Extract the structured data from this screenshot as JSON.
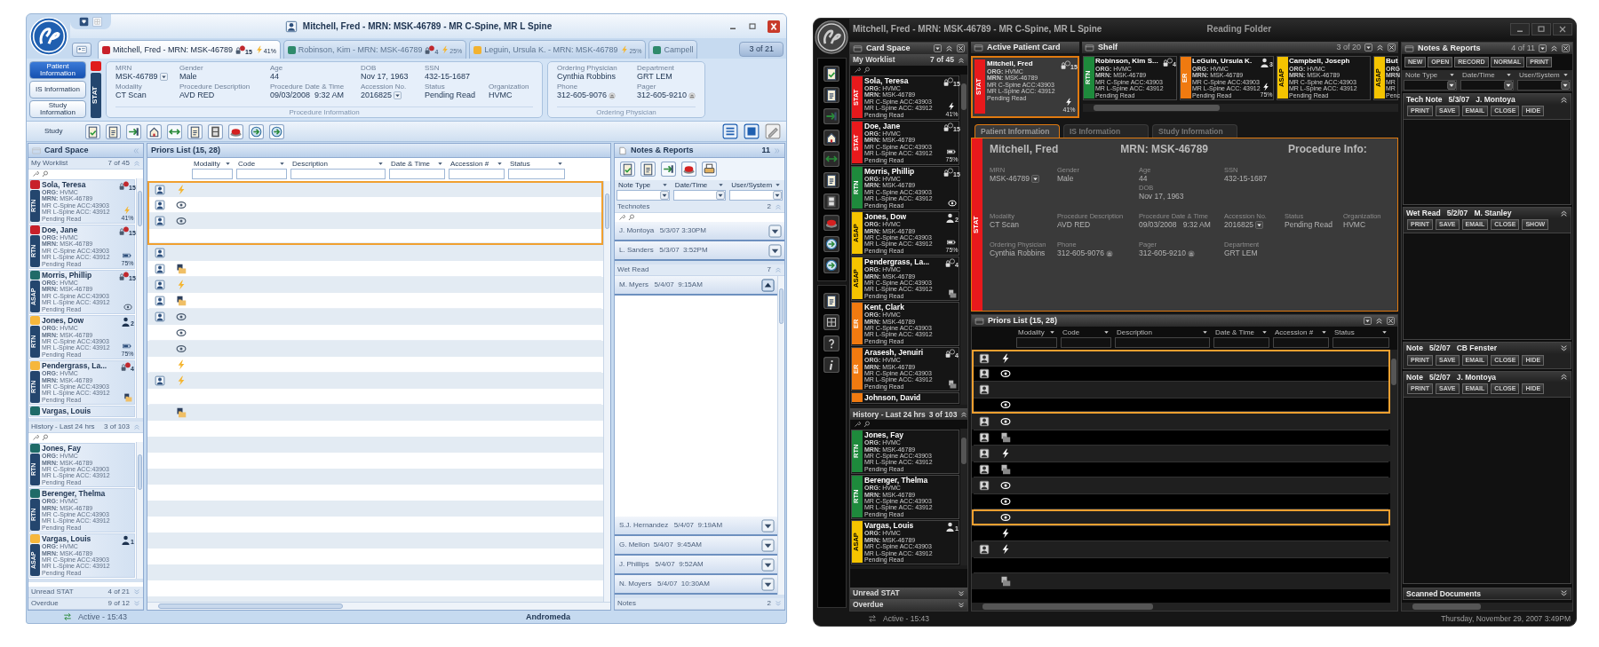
{
  "light": {
    "title": "Mitchell, Fred - MRN: MSK-46789 - MR C-Spine, MR L Spine",
    "patient_tabs": [
      {
        "label": "Mitchell, Fred - MRN: MSK-46789",
        "color": "#c8202a",
        "selected": true,
        "badge": {
          "kind": "lock",
          "count": "15"
        },
        "indicator": {
          "kind": "bolt",
          "reading": "41%"
        }
      },
      {
        "label": "Robinson, Kim - MRN: MSK-46789",
        "color": "#2f8a6c",
        "selected": false,
        "badge": {
          "kind": "lock",
          "count": "4"
        },
        "indicator": {
          "kind": "bolt",
          "reading": "25%"
        }
      },
      {
        "label": "Leguin, Ursula K. - MRN: MSK-46789",
        "color": "#f2b230",
        "selected": false,
        "indicator": {
          "kind": "bolt",
          "reading": "25%"
        }
      },
      {
        "label": "Campell",
        "color": "#2f8a6c",
        "selected": false
      }
    ],
    "tab_counter": "3 of 21",
    "info_tabs": [
      {
        "label": "Patient Information",
        "selected": true
      },
      {
        "label": "IS Information",
        "selected": false
      },
      {
        "label": "Study Information",
        "selected": false
      }
    ],
    "stat": {
      "label": "STAT",
      "color": "#e01b1b"
    },
    "procedure_info": {
      "caption": "Procedure Information",
      "rows": [
        [
          {
            "label": "MRN",
            "value": "MSK-46789",
            "kind": "dropdown"
          },
          {
            "label": "Gender",
            "value": "Male",
            "kind": "text"
          },
          {
            "label": "Age",
            "value": "44",
            "kind": "text"
          },
          {
            "label": "DOB",
            "value": "Nov 17, 1963",
            "kind": "text"
          },
          {
            "label": "SSN",
            "value": "432-15-1687",
            "kind": "text"
          }
        ],
        [
          {
            "label": "Modality",
            "value": "CT Scan",
            "kind": "text"
          },
          {
            "label": "Procedure Description",
            "value": "AVD RED",
            "kind": "text"
          },
          {
            "label": "Procedure Date & Time",
            "value": "09/03/2008  9:32 AM",
            "kind": "text"
          },
          {
            "label": "Accession No.",
            "value": "2016825",
            "kind": "dropdown"
          },
          {
            "label": "Status",
            "value": "Pending Read",
            "kind": "text"
          },
          {
            "label": "Organization",
            "value": "HVMC",
            "kind": "text"
          }
        ]
      ]
    },
    "ordering_physician": {
      "caption": "Ordering Physician",
      "rows": [
        [
          {
            "label": "Ordering Physician",
            "value": "Cynthia Robbins",
            "kind": "text"
          },
          {
            "label": "Department",
            "value": "GRT LEM",
            "kind": "text"
          }
        ],
        [
          {
            "label": "Phone",
            "value": "312-605-9076",
            "kind": "phone"
          },
          {
            "label": "Pager",
            "value": "312-605-9210",
            "kind": "phone"
          }
        ]
      ]
    },
    "toolbar_label": "Study",
    "card_space": {
      "title": "Card Space",
      "sections": [
        {
          "title": "My Worklist",
          "count": "7 of 45",
          "expanded": true,
          "cards": [
            {
              "name": "Sola, Teresa",
              "priority": "RTN",
              "color": "#c8202a",
              "lines": [
                "**ORG:** HVMC",
                "**MRN:** MSK-46789",
                "MR C-Spine ACC:43903",
                "MR L-Spine ACC: 43912",
                "Pending Read"
              ],
              "badge": {
                "kind": "lock",
                "count": "15"
              },
              "indicator": {
                "kind": "bolt",
                "reading": "41%"
              }
            },
            {
              "name": "Doe, Jane",
              "priority": "RTN",
              "color": "#c8202a",
              "lines": [
                "**ORG:** HVMC",
                "**MRN:** MSK-46789",
                "MR C-Spine ACC:43903",
                "MR L-Spine ACC: 43912",
                "Pending Read"
              ],
              "badge": {
                "kind": "lock",
                "count": "15"
              },
              "indicator": {
                "kind": "battery",
                "reading": "75%"
              }
            },
            {
              "name": "Morris, Phillip",
              "priority": "ASAP",
              "color": "#1f6b68",
              "lines": [
                "**ORG:** HVMC",
                "**MRN:** MSK-46789",
                "MR C-Spine ACC:43903",
                "MR L-Spine ACC: 43912",
                "Pending Read"
              ],
              "badge": {
                "kind": "lock",
                "count": "15"
              },
              "indicator": {
                "kind": "eye"
              }
            },
            {
              "name": "Jones, Dow",
              "priority": "RTN",
              "color": "#f6b73c",
              "lines": [
                "**ORG:** HVMC",
                "**MRN:** MSK-46789",
                "MR C-Spine ACC:43903",
                "MR L-Spine ACC: 43912",
                "Pending Read"
              ],
              "badge": {
                "kind": "person",
                "count": "2"
              },
              "indicator": {
                "kind": "battery",
                "reading": "75%"
              }
            },
            {
              "name": "Pendergrass, La...",
              "priority": "RTN",
              "color": "#f6b73c",
              "lines": [
                "**ORG:** HVMC",
                "**MRN:** MSK-46789",
                "MR C-Spine ACC:43903",
                "MR L-Spine ACC: 43912",
                "Pending Read"
              ],
              "badge": {
                "kind": "lock",
                "count": "4"
              },
              "indicator": {
                "kind": "folder"
              }
            },
            {
              "name": "Vargas, Louis",
              "color": "#1f6b68"
            }
          ]
        },
        {
          "title": "History - Last 24 hrs",
          "count": "3 of 103",
          "expanded": true,
          "cards": [
            {
              "name": "Jones, Fay",
              "priority": "RTN",
              "color": "#1f6b68",
              "lines": [
                "**ORG:** HVMC",
                "**MRN:** MSK-46789",
                "MR C-Spine ACC:43903",
                "MR L-Spine ACC: 43912",
                "Pending Read"
              ]
            },
            {
              "name": "Berenger, Thelma",
              "priority": "RTN",
              "color": "#1f6b68",
              "lines": [
                "**ORG:** HVMC",
                "**MRN:** MSK-46789",
                "MR C-Spine ACC:43903",
                "MR L-Spine ACC: 43912",
                "Pending Read"
              ]
            },
            {
              "name": "Vargas, Louis",
              "priority": "ASAP",
              "color": "#f6b73c",
              "lines": [
                "**ORG:** HVMC",
                "**MRN:** MSK-46789",
                "MR C-Spine ACC:43903",
                "MR L-Spine ACC: 43912",
                "Pending Read"
              ],
              "badge": {
                "kind": "person",
                "count": "1"
              }
            }
          ]
        },
        {
          "title": "Unread STAT",
          "count": "4 of 21",
          "expanded": false
        },
        {
          "title": "Overdue",
          "count": "9 of 12",
          "expanded": false
        }
      ]
    },
    "priors": {
      "title": "Priors List (15, 28)",
      "columns": [
        "Modality",
        "Code",
        "Description",
        "Date & Time",
        "Accession #",
        "Status"
      ],
      "rows": [
        {
          "image": true,
          "kind": "bolt",
          "selected": true
        },
        {
          "image": true,
          "kind": "eye",
          "selected": true
        },
        {
          "image": true,
          "kind": "eye",
          "selected": true
        },
        {
          "selected": true
        },
        {
          "image": true,
          "selected": false
        },
        {
          "image": true,
          "kind": "folder",
          "selected": false
        },
        {
          "image": true,
          "kind": "bolt",
          "selected": false
        },
        {
          "image": true,
          "kind": "folder",
          "selected": false
        },
        {
          "image": true,
          "kind": "eye",
          "selected": false
        },
        {
          "kind": "eye",
          "selected": false
        },
        {
          "kind": "eye",
          "selected": false
        },
        {
          "kind": "bolt",
          "selected": false
        },
        {
          "image": true,
          "kind": "bolt",
          "selected": false
        },
        {
          "selected": false
        },
        {
          "kind": "folder",
          "selected": false
        }
      ]
    },
    "notes": {
      "title": "Notes & Reports",
      "count": "11",
      "filters": [
        "Note Type",
        "Date/Time",
        "User/System"
      ],
      "sections": [
        {
          "title": "Technotes",
          "count": "2",
          "expanded": true,
          "notes": [
            {
              "text": "J. Montoya   5/3/07 3:30PM",
              "expanded": false
            },
            {
              "text": "L. Sanders   5/3/07  3:52PM",
              "expanded": false
            }
          ]
        },
        {
          "title": "Wet Read",
          "count": "7",
          "expanded": true,
          "notes": [
            {
              "text": "M. Myers   5/4/07  9:15AM",
              "expanded": true
            },
            {
              "text": "S.J. Hernandez   5/4/07  9:19AM",
              "expanded": false
            },
            {
              "text": "G. Mellon  5/4/07  9:45AM",
              "expanded": false
            },
            {
              "text": "J. Phillips   5/4/07  9:52AM",
              "expanded": false
            },
            {
              "text": "N. Moyers   5/4/07  10:30AM",
              "expanded": false
            }
          ]
        },
        {
          "title": "Notes",
          "count": "2",
          "expanded": false
        }
      ]
    },
    "status": "Active - 15:43",
    "server": "Andromeda"
  },
  "dark": {
    "title": "Mitchell, Fred - MRN: MSK-46789 - MR C-Spine, MR L Spine",
    "folder": "Reading Folder",
    "card_space": {
      "title": "Card Space",
      "sections": [
        {
          "title": "My Worklist",
          "count": "7 of 45",
          "expanded": true,
          "cards": [
            {
              "name": "Sola, Teresa",
              "priority": "STAT",
              "color": "#e8191c",
              "lines": [
                "**ORG:** HVMC",
                "**MRN:** MSK-46789",
                "MR C-Spine ACC:43903",
                "MR L-Spine ACC: 43912",
                "Pending Read"
              ],
              "badge": {
                "kind": "lock",
                "count": "15"
              },
              "indicator": {
                "kind": "bolt",
                "reading": "41%"
              }
            },
            {
              "name": "Doe, Jane",
              "priority": "STAT",
              "color": "#e8191c",
              "lines": [
                "**ORG:** HVMC",
                "**MRN:** MSK-46789",
                "MR C-Spine ACC:43903",
                "MR L-Spine ACC: 43912",
                "Pending Read"
              ],
              "badge": {
                "kind": "lock",
                "count": "15"
              },
              "indicator": {
                "kind": "battery",
                "reading": "75%"
              }
            },
            {
              "name": "Morris, Phillip",
              "priority": "RTN",
              "color": "#1e8a3c",
              "lines": [
                "**ORG:** HVMC",
                "**MRN:** MSK-46789",
                "MR C-Spine ACC:43903",
                "MR L-Spine ACC: 43912",
                "Pending Read"
              ],
              "badge": {
                "kind": "lock",
                "count": "15"
              },
              "indicator": {
                "kind": "eye"
              }
            },
            {
              "name": "Jones, Dow",
              "priority": "ASAP",
              "color": "#f5c400",
              "lines": [
                "**ORG:** HVMC",
                "**MRN:** MSK-46789",
                "MR C-Spine ACC:43903",
                "MR L-Spine ACC: 43912",
                "Pending Read"
              ],
              "badge": {
                "kind": "person",
                "count": "2"
              },
              "indicator": {
                "kind": "battery",
                "reading": "75%"
              }
            },
            {
              "name": "Pendergrass, La...",
              "priority": "ASAP",
              "color": "#f5c400",
              "lines": [
                "**ORG:** HVMC",
                "**MRN:** MSK-46789",
                "MR C-Spine ACC:43903",
                "MR L-Spine ACC: 43912",
                "Pending Read"
              ],
              "badge": {
                "kind": "lock",
                "count": "4"
              },
              "indicator": {
                "kind": "folder"
              }
            },
            {
              "name": "Kent, Clark",
              "priority": "ER",
              "color": "#f07a10",
              "lines": [
                "**ORG:** HVMC",
                "**MRN:** MSK-46789",
                "MR C-Spine ACC:43903",
                "MR L-Spine ACC: 43912",
                "Pending Read"
              ]
            },
            {
              "name": "Arasesh, Jenuiri",
              "priority": "ER",
              "color": "#f07a10",
              "lines": [
                "**ORG:** HVMC",
                "**MRN:** MSK-46789",
                "MR C-Spine ACC:43903",
                "MR L-Spine ACC: 43912",
                "Pending Read"
              ],
              "badge": {
                "kind": "lock",
                "count": "4"
              },
              "indicator": {
                "kind": "folder"
              }
            },
            {
              "name": "Johnson, David",
              "color": "#f07a10"
            }
          ]
        },
        {
          "title": "History - Last 24 hrs",
          "count": "3 of 103",
          "expanded": true,
          "cards": [
            {
              "name": "Jones, Fay",
              "priority": "RTN",
              "color": "#1e8a3c",
              "lines": [
                "**ORG:** HVMC",
                "**MRN:** MSK-46789",
                "MR C-Spine ACC:43903",
                "MR L-Spine ACC: 43912",
                "Pending Read"
              ]
            },
            {
              "name": "Berenger, Thelma",
              "priority": "RTN",
              "color": "#1e8a3c",
              "lines": [
                "**ORG:** HVMC",
                "**MRN:** MSK-46789",
                "MR C-Spine ACC:43903",
                "MR L-Spine ACC: 43912",
                "Pending Read"
              ]
            },
            {
              "name": "Vargas, Louis",
              "priority": "ASAP",
              "color": "#f5c400",
              "lines": [
                "**ORG:** HVMC",
                "**MRN:** MSK-46789",
                "MR C-Spine ACC:43903",
                "MR L-Spine ACC: 43912",
                "Pending Read"
              ],
              "badge": {
                "kind": "person",
                "count": "1"
              }
            }
          ]
        },
        {
          "title": "Unread STAT",
          "expanded": false
        },
        {
          "title": "Overdue",
          "expanded": false
        }
      ]
    },
    "active_card": {
      "title": "Active Patient Card",
      "card": {
        "name": "Mitchell, Fred",
        "priority": "STAT",
        "color": "#e8191c",
        "lines": [
          "**ORG:** HVMC",
          "**MRN:** MSK-46789",
          "MR C-Spine ACC:43903",
          "MR L-Spine ACC: 43912",
          "Pending Read"
        ],
        "badge": {
          "kind": "lock",
          "count": "15"
        },
        "indicator": {
          "kind": "bolt",
          "reading": "41%"
        }
      }
    },
    "shelf": {
      "title": "Shelf",
      "count": "3 of 20",
      "cards": [
        {
          "name": "Robinson, Kim S...",
          "priority": "RTN",
          "color": "#1e8a3c",
          "lines": [
            "**ORG:** HVMC",
            "**MRN:** MSK-46789",
            "MR C-Spine ACC:43903",
            "MR L-Spine ACC: 43912",
            "Pending Read"
          ],
          "badge": {
            "kind": "lock",
            "count": "4"
          }
        },
        {
          "name": "LeGuin, Ursula K.",
          "priority": "ER",
          "color": "#f07a10",
          "lines": [
            "**ORG:** HVMC",
            "**MRN:** MSK-46789",
            "MR C-Spine ACC:43903",
            "MR L-Spine ACC: 43912",
            "Pending Read"
          ],
          "badge": {
            "kind": "person",
            "count": "3"
          },
          "indicator": {
            "kind": "bolt",
            "reading": "75%"
          }
        },
        {
          "name": "Campbell, Joseph",
          "priority": "ASAP",
          "color": "#f5c400",
          "lines": [
            "**ORG:** HVMC",
            "**MRN:** MSK-46789",
            "MR C-Spine ACC:43903",
            "MR L-Spine ACC: 43912",
            "Pending Read"
          ]
        },
        {
          "name": "But",
          "priority": "ASAP",
          "color": "#f5c400",
          "lines": [
            "**ORG**",
            "**MRN**",
            "MR",
            "MR",
            "Penc"
          ]
        }
      ]
    },
    "info_tabs": [
      {
        "label": "Patient Information",
        "selected": true
      },
      {
        "label": "IS Information",
        "selected": false
      },
      {
        "label": "Study Information",
        "selected": false
      }
    ],
    "patient": {
      "name": "Mitchell, Fred",
      "mrn": "MRN: MSK-46789",
      "section": "Procedure Info:",
      "priority": "STAT",
      "color": "#e8191c",
      "rows": [
        [
          {
            "label": "MRN",
            "value": "MSK-46789",
            "kind": "dropdown"
          },
          {
            "label": "Gender",
            "value": "Male",
            "kind": "text"
          },
          {
            "label": "Age",
            "value": "44",
            "kind": "text",
            "below": {
              "label": "DOB",
              "value": "Nov 17, 1963"
            }
          },
          {
            "label": "SSN",
            "value": "432-15-1687",
            "kind": "text"
          }
        ],
        [
          {
            "label": "Modality",
            "value": "CT Scan",
            "kind": "text"
          },
          {
            "label": "Procedure Description",
            "value": "AVD RED",
            "kind": "text"
          },
          {
            "label": "Procedure Date & Time",
            "value": "09/03/2008   9:32 AM",
            "kind": "text"
          },
          {
            "label": "Accession No.",
            "value": "2016825",
            "kind": "dropdown"
          },
          {
            "label": "Status",
            "value": "Pending Read",
            "kind": "text"
          },
          {
            "label": "Organization",
            "value": "HVMC",
            "kind": "text"
          }
        ],
        [
          {
            "label": "Ordering Physician",
            "value": "Cynthia Robbins",
            "kind": "text"
          },
          {
            "label": "Phone",
            "value": "312-605-9076",
            "kind": "phone"
          },
          {
            "label": "Pager",
            "value": "312-605-9210",
            "kind": "phone"
          },
          {
            "label": "Department",
            "value": "GRT LEM",
            "kind": "text"
          }
        ]
      ]
    },
    "priors": {
      "title": "Priors List (15, 28)",
      "columns": [
        "Modality",
        "Code",
        "Description",
        "Date & Time",
        "Accession #",
        "Status"
      ],
      "rows": [
        {
          "image": true,
          "kind": "bolt",
          "selected": true
        },
        {
          "image": true,
          "kind": "eye",
          "selected": true
        },
        {
          "image": true,
          "selected": true
        },
        {
          "kind": "eye",
          "selected": true
        },
        {
          "image": true,
          "kind": "eye",
          "selected": false
        },
        {
          "image": true,
          "kind": "folder",
          "selected": false
        },
        {
          "image": true,
          "kind": "bolt",
          "selected": false
        },
        {
          "image": true,
          "kind": "folder",
          "selected": false
        },
        {
          "image": true,
          "kind": "eye",
          "selected": false
        },
        {
          "kind": "eye",
          "selected": false
        },
        {
          "kind": "eye",
          "selected": true
        },
        {
          "kind": "bolt",
          "selected": false
        },
        {
          "image": true,
          "kind": "bolt",
          "selected": false
        },
        {
          "selected": false
        },
        {
          "kind": "folder",
          "selected": false
        }
      ]
    },
    "notes": {
      "title": "Notes & Reports",
      "count": "4 of 11",
      "buttons": [
        "NEW",
        "OPEN",
        "RECORD",
        "NORMAL",
        "PRINT"
      ],
      "filters": [
        "Note Type",
        "Date/Time",
        "User/System"
      ],
      "items": [
        {
          "title": "Tech Note   5/3/07   J. Montoya",
          "expanded": true,
          "actions": [
            "PRINT",
            "SAVE",
            "EMAIL",
            "CLOSE",
            "HIDE"
          ]
        },
        {
          "title": "Wet Read   5/2/07   M. Stanley",
          "expanded": true,
          "actions": [
            "PRINT",
            "SAVE",
            "EMAIL",
            "CLOSE",
            "SHOW"
          ]
        },
        {
          "title": "Note   5/2/07   CB Fenster",
          "expanded": false,
          "actions": [
            "PRINT",
            "SAVE",
            "EMAIL",
            "CLOSE",
            "HIDE"
          ]
        },
        {
          "title": "Note   5/2/07   J. Montoya",
          "expanded": true,
          "actions": [
            "PRINT",
            "SAVE",
            "EMAIL",
            "CLOSE",
            "HIDE"
          ]
        },
        {
          "title": "Scanned Documents",
          "expanded": false
        }
      ]
    },
    "status": "Active - 15:43",
    "date": "Thursday, November 29, 2007  3:49PM"
  }
}
